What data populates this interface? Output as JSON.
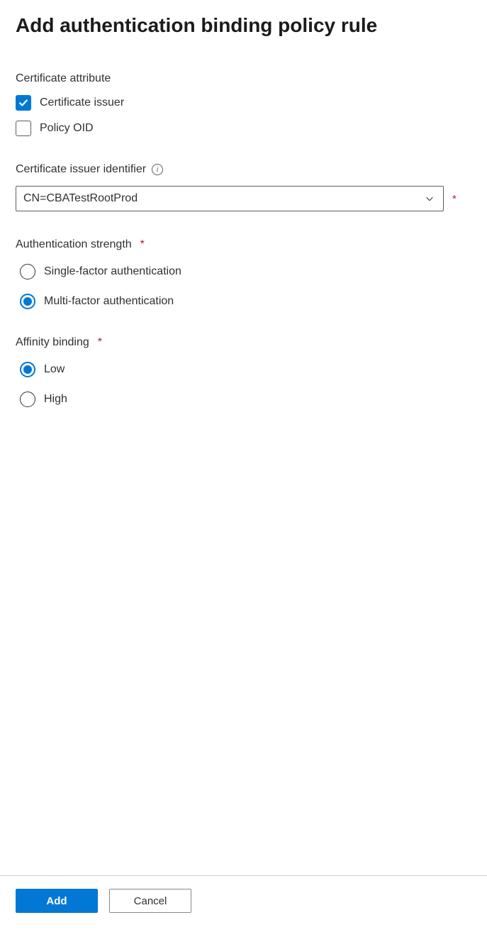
{
  "title": "Add authentication binding policy rule",
  "cert_attr": {
    "label": "Certificate attribute",
    "options": [
      {
        "label": "Certificate issuer",
        "checked": true
      },
      {
        "label": "Policy OID",
        "checked": false
      }
    ]
  },
  "issuer_id": {
    "label": "Certificate issuer identifier",
    "required": true,
    "value": "CN=CBATestRootProd"
  },
  "auth_strength": {
    "label": "Authentication strength",
    "required": true,
    "options": [
      {
        "label": "Single-factor authentication",
        "selected": false
      },
      {
        "label": "Multi-factor authentication",
        "selected": true
      }
    ]
  },
  "affinity": {
    "label": "Affinity binding",
    "required": true,
    "options": [
      {
        "label": "Low",
        "selected": true
      },
      {
        "label": "High",
        "selected": false
      }
    ]
  },
  "footer": {
    "add_label": "Add",
    "cancel_label": "Cancel"
  }
}
